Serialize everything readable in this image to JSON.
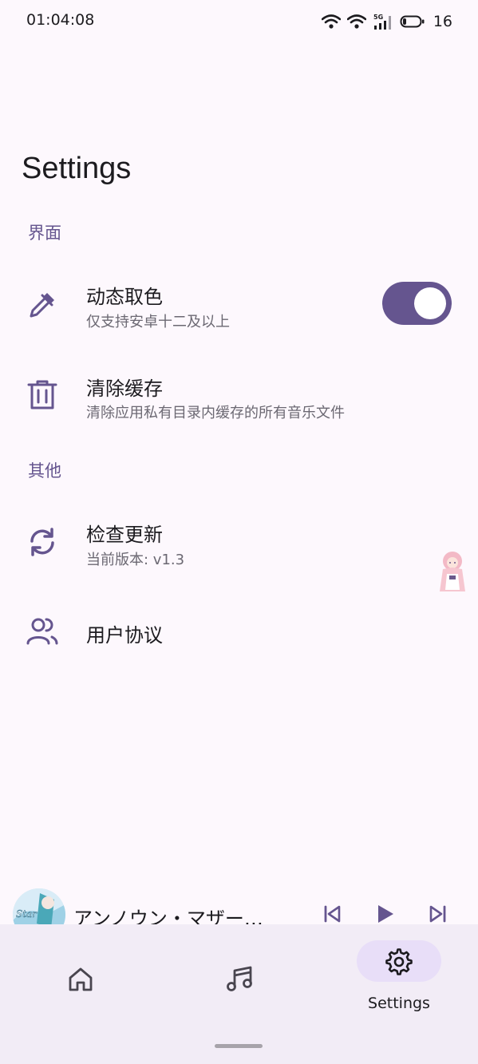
{
  "status_bar": {
    "time": "01:04:08",
    "network_type": "5G",
    "battery": "16"
  },
  "page": {
    "title": "Settings"
  },
  "sections": {
    "interface": {
      "header": "界面",
      "dynamic_color": {
        "title": "动态取色",
        "subtitle": "仅支持安卓十二及以上",
        "enabled": true
      },
      "clear_cache": {
        "title": "清除缓存",
        "subtitle": "清除应用私有目录内缓存的所有音乐文件"
      }
    },
    "other": {
      "header": "其他",
      "check_update": {
        "title": "检查更新",
        "subtitle": "当前版本: v1.3"
      },
      "user_agreement": {
        "title": "用户协议"
      }
    }
  },
  "player": {
    "track_title": "アンノウン・マザー…",
    "album_art_text": "Star"
  },
  "nav": {
    "items": [
      {
        "icon": "home-icon"
      },
      {
        "icon": "music-note-icon"
      },
      {
        "icon": "gear-icon",
        "label": "Settings",
        "selected": true
      }
    ]
  },
  "colors": {
    "accent": "#65558f",
    "background": "#fdf8fd",
    "nav_background": "#f2ecf6",
    "nav_indicator": "#e8def8"
  }
}
